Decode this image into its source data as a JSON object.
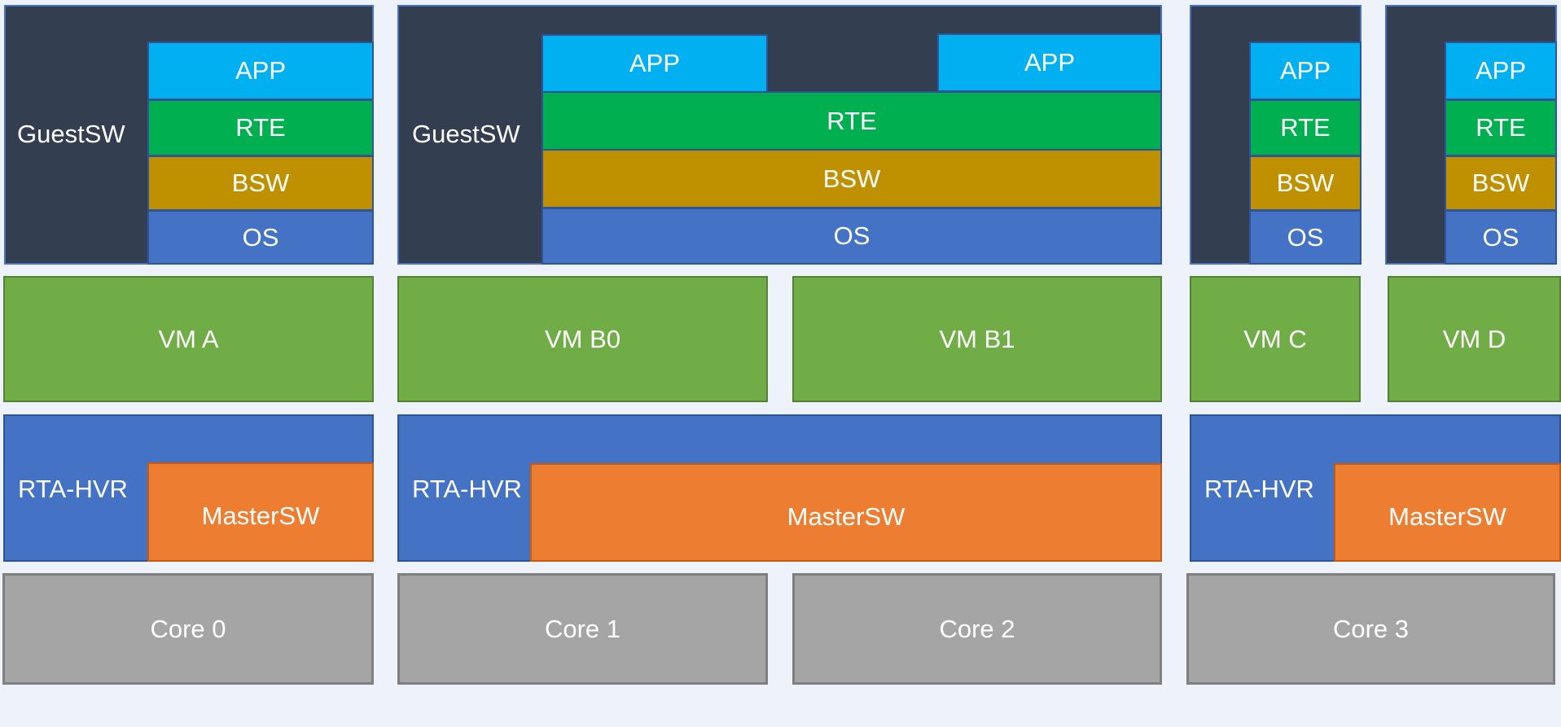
{
  "colors": {
    "background": "#eef2fa",
    "guest_sw": "#333e50",
    "app": "#00b0f0",
    "rte": "#00b050",
    "bsw": "#bf9000",
    "os": "#4472c4",
    "vm": "#70ad47",
    "hypervisor": "#4472c4",
    "master_sw": "#ed7d31",
    "core": "#a5a5a5"
  },
  "guests": [
    {
      "label": "GuestSW",
      "layers": {
        "app": [
          "APP"
        ],
        "rte": "RTE",
        "bsw": "BSW",
        "os": "OS"
      }
    },
    {
      "label": "GuestSW",
      "layers": {
        "app": [
          "APP",
          "APP"
        ],
        "rte": "RTE",
        "bsw": "BSW",
        "os": "OS"
      }
    },
    {
      "label": "",
      "layers": {
        "app": [
          "APP"
        ],
        "rte": "RTE",
        "bsw": "BSW",
        "os": "OS"
      }
    },
    {
      "label": "",
      "layers": {
        "app": [
          "APP"
        ],
        "rte": "RTE",
        "bsw": "BSW",
        "os": "OS"
      }
    }
  ],
  "vms": [
    "VM A",
    "VM B0",
    "VM B1",
    "VM C",
    "VM D"
  ],
  "hypervisors": [
    {
      "label": "RTA-HVR",
      "master": "MasterSW"
    },
    {
      "label": "RTA-HVR",
      "master": "MasterSW"
    },
    {
      "label": "RTA-HVR",
      "master": "MasterSW"
    }
  ],
  "cores": [
    "Core 0",
    "Core 1",
    "Core 2",
    "Core 3"
  ]
}
